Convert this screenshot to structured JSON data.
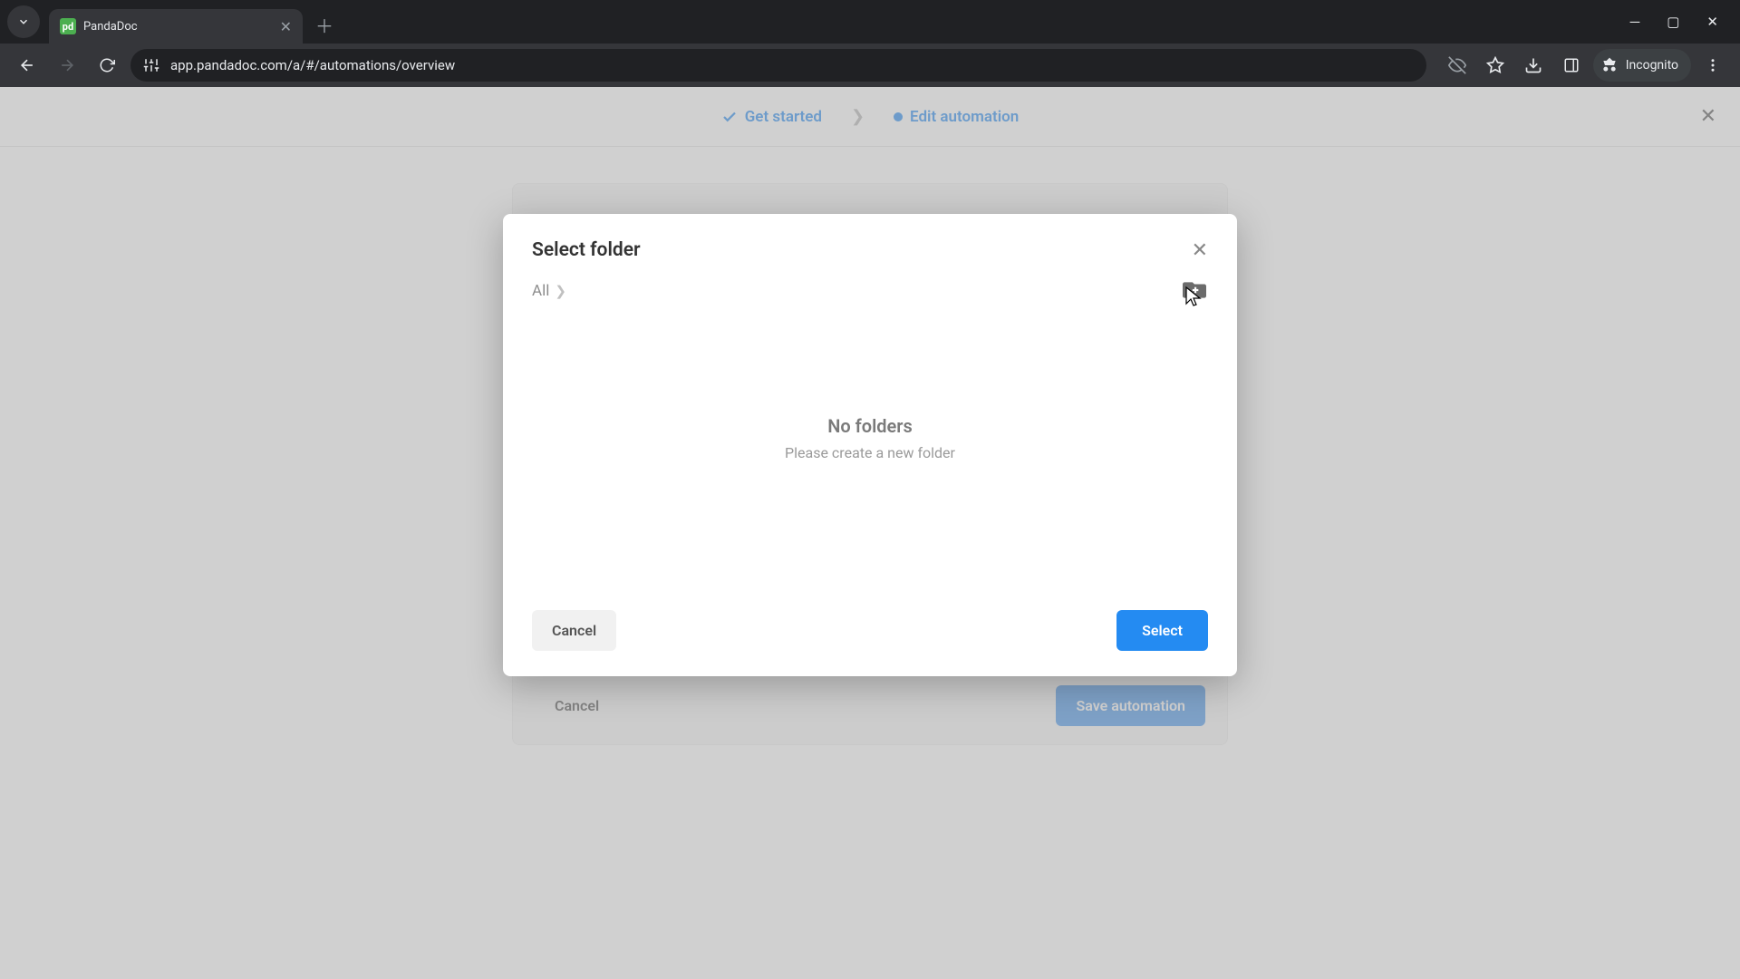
{
  "browser": {
    "tab_title": "PandaDoc",
    "url": "app.pandadoc.com/a/#/automations/overview",
    "incognito_label": "Incognito"
  },
  "wizard": {
    "step1": "Get started",
    "step2": "Edit automation"
  },
  "background": {
    "cancel": "Cancel",
    "save": "Save automation"
  },
  "modal": {
    "title": "Select folder",
    "breadcrumb_root": "All",
    "empty_title": "No folders",
    "empty_subtitle": "Please create a new folder",
    "cancel": "Cancel",
    "select": "Select"
  }
}
